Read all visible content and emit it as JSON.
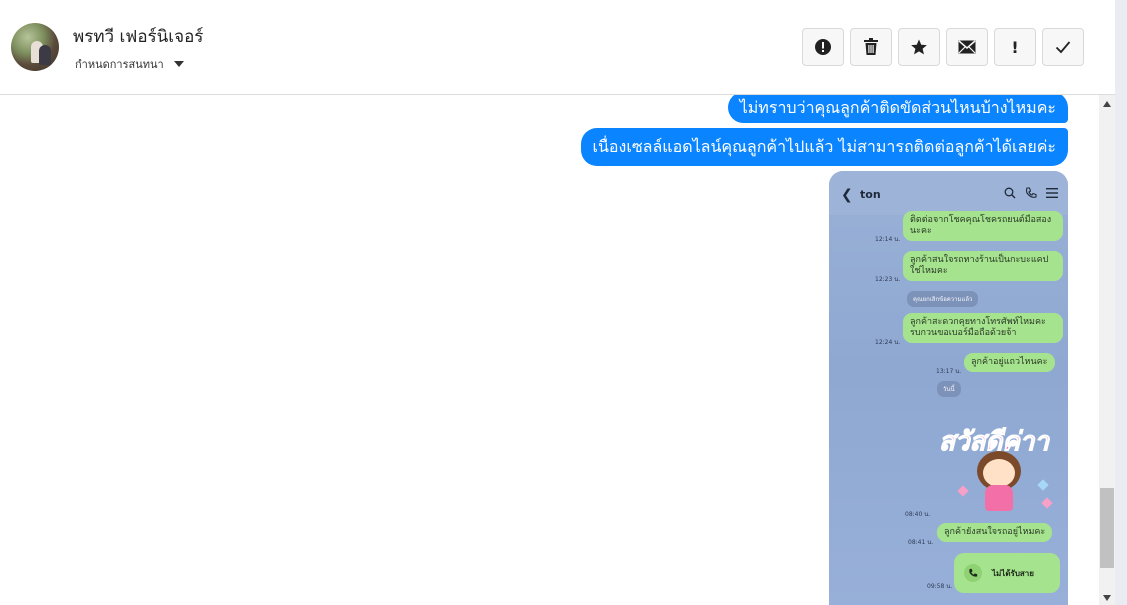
{
  "header": {
    "contact_name": "พรทวี เฟอร์นิเจอร์",
    "subtitle": "กำหนดการสนทนา",
    "toolbar": {
      "report_icon": "exclamation-circle-icon",
      "delete_icon": "trash-icon",
      "star_icon": "star-icon",
      "mail_icon": "envelope-icon",
      "important_label": "!",
      "done_icon": "check-icon"
    }
  },
  "messages": [
    {
      "text": "ไม่ทราบว่าคุณลูกค้าติดขัดส่วนไหนบ้างไหมคะ"
    },
    {
      "text": "เนื่องเซลล์แอดไลน์คุณลูกค้าไปแล้ว ไม่สามารถติดต่อลูกค้าได้เลยค่ะ"
    }
  ],
  "attachment": {
    "chat_title": "ton",
    "bubbles": [
      {
        "time": "12:14 น.",
        "text": "ติดต่อจากโชคคุณโชครถยนต์มือสองนะคะ"
      },
      {
        "time": "12:23 น.",
        "text": "ลูกค้าสนใจรถทางร้านเป็นกะบะแคปใช่ไหมคะ"
      },
      {
        "time": "12:24 น.",
        "text": "ลูกค้าสะดวกคุยทางโทรศัพท์ไหมคะรบกวนขอเบอร์มือถือด้วยจ้า"
      },
      {
        "time": "13:17 น.",
        "text": "ลูกค้าอยู่แถวไหนคะ"
      },
      {
        "time": "08:41 น.",
        "text": "ลูกค้ายังสนใจรถอยู่ไหมคะ"
      }
    ],
    "unsent_notice": "คุณยกเลิกข้อความแล้ว",
    "date_pill": "วันนี้",
    "sticker_text": "สวัสดีค่าา",
    "sticker_time": "08:40 น.",
    "call_label": "ไม่ได้รับสาย",
    "call_time": "09:58 น."
  },
  "colors": {
    "outgoing_bubble": "#0b84ff",
    "line_bubble": "#a6e38e",
    "line_background": "#8ea8d2"
  }
}
